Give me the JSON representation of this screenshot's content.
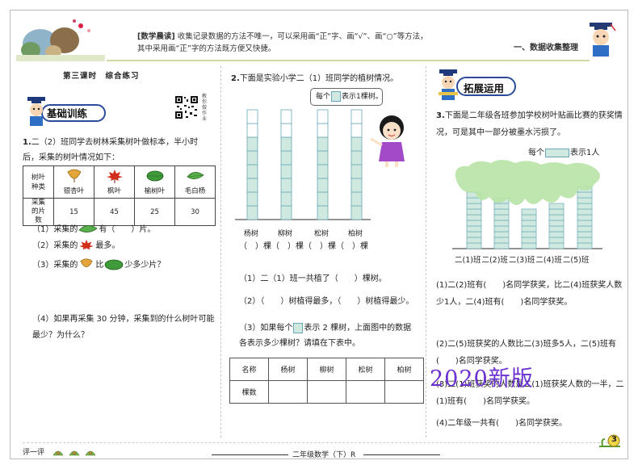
{
  "header": {
    "morning_read_tag": "[数学晨读]",
    "morning_read_line1": "收集记录数据的方法不唯一，可以采用画“正”字、画“√”、画“○”等方法，",
    "morning_read_line2": "其中采用画“正”字的方法既方便又快捷。",
    "section_title": "一、数据收集整理"
  },
  "left": {
    "lesson_title": "第三课时　综合练习",
    "qr_side": "教你做作业",
    "badge": "基础训练",
    "q1_intro_num": "1.",
    "q1_intro": "二（2）班同学去树林采集树叶做标本，半小时后，采集的树叶情况如下：",
    "table": {
      "header_label": "树叶种类",
      "count_label": "采集的片数",
      "leaves": [
        {
          "name": "银杏叶",
          "count": "15"
        },
        {
          "name": "枫叶",
          "count": "45"
        },
        {
          "name": "榆树叶",
          "count": "25"
        },
        {
          "name": "毛白杨",
          "count": "30"
        }
      ]
    },
    "q1_1a": "（1）采集的",
    "q1_1b": "有（　　）片。",
    "q1_2a": "（2）采集的",
    "q1_2b": "最多。",
    "q1_3a": "（3）采集的",
    "q1_3b": "比",
    "q1_3c": "少多少片？",
    "q1_4": "（4）如果再采集 30 分钟，采集到的什么树叶可能最少？为什么？"
  },
  "middle": {
    "q2_num": "2.",
    "q2": "下面是实验小学二（1）班同学的植树情况。",
    "bubble_a": "每个",
    "bubble_b": "表示1棵树。",
    "trees": [
      {
        "name": "杨树",
        "value": 6
      },
      {
        "name": "柳树",
        "value": 6
      },
      {
        "name": "松树",
        "value": 6
      },
      {
        "name": "柏树",
        "value": 6
      }
    ],
    "blank_row": "（　）棵（　）棵（　）棵（　）棵",
    "q2_1": "（1）二（1）班一共植了（　　）棵树。",
    "q2_2": "（2）（　　）树植得最多，（　　）树植得最少。",
    "q2_3a": "（3）如果每个",
    "q2_3b": "表示 2 棵树，上面图中的数据各表示多少棵树？请填在下表中。",
    "table_headers": [
      "名称",
      "杨树",
      "柳树",
      "松树",
      "柏树"
    ],
    "table_row_label": "棵数",
    "watermark": "2020新版"
  },
  "right": {
    "badge": "拓展运用",
    "q3_num": "3.",
    "q3": "下面是二年级各班参加学校树叶贴画比赛的获奖情况，可是其中一部分被墨水污损了。",
    "legend_a": "每个",
    "legend_b": "表示1人",
    "classes": [
      "二(1)班",
      "二(2)班",
      "二(3)班",
      "二(4)班",
      "二(5)班"
    ],
    "q3_1": "(1)二(2)班有(　　)名同学获奖，比二(4)班获奖人数少1人，二(4)班有(　　)名同学获奖。",
    "q3_2": "(2)二(5)班获奖的人数比二(3)班多5人，二(5)班有(　　)名同学获奖。",
    "q3_3": "(3)二(1)班获奖的人数是二(1)班获奖人数的一半，二(1)班有(　　)名同学获奖。",
    "q3_4": "(4)二年级一共有(　　)名同学获奖。"
  },
  "footer": {
    "eval": "评一评",
    "title": "二年级数学（下）R",
    "page": "3"
  },
  "colors": {
    "grid_fill": "#cfe9e0",
    "grid_stroke": "#6aa8b5",
    "ink_blot": "#b8e3a6",
    "watermark": "#6b31d1"
  }
}
